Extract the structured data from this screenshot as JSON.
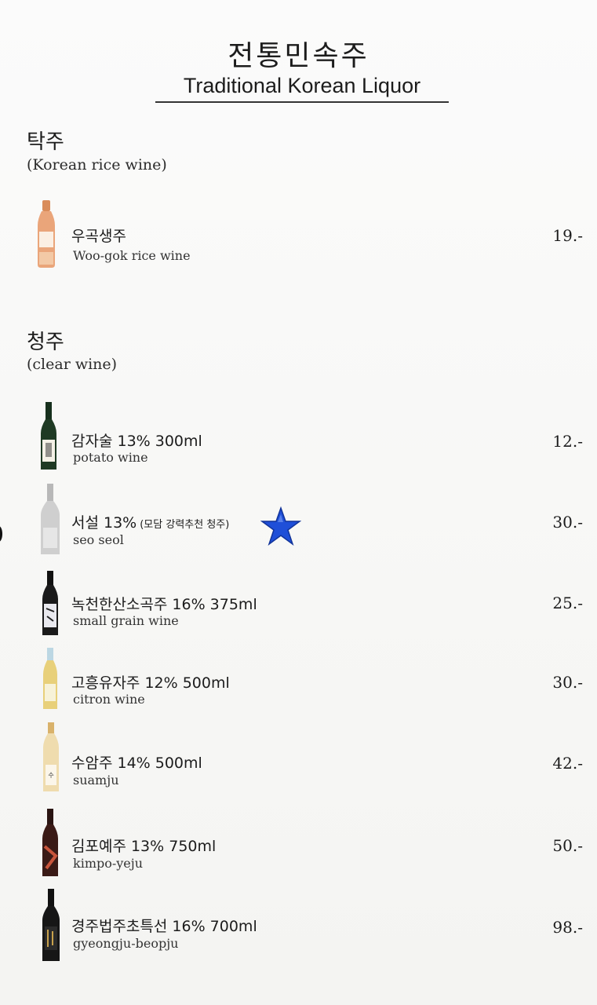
{
  "header": {
    "title_ko": "전통민속주",
    "title_en": "Traditional Korean Liquor"
  },
  "sections": [
    {
      "title": "탁주",
      "subtitle": "(Korean rice wine)",
      "items": [
        {
          "name": "우곡생주",
          "desc": "Woo-gok rice wine",
          "price": "19.-",
          "bottle_color": "#e9a57c"
        }
      ]
    },
    {
      "title": "청주",
      "subtitle": "(clear wine)",
      "items": [
        {
          "name": "감자술 13% 300ml",
          "desc": "potato wine",
          "price": "12.-",
          "bottle_color": "#1f3a24"
        },
        {
          "name": "서설 13%",
          "note": "(모담 강력추천 청주)",
          "desc": "seo seol",
          "price": "30.-",
          "bottle_color": "#c9c9c9",
          "badge": "star-icon",
          "badge_color": "#1f4fd8"
        },
        {
          "name": "녹천한산소곡주 16% 375ml",
          "desc": "small grain wine",
          "price": "25.-",
          "bottle_color": "#1a1a1a"
        },
        {
          "name": "고흥유자주 12% 500ml",
          "desc": "citron wine",
          "price": "30.-",
          "bottle_color": "#e8d07a"
        },
        {
          "name": "수암주 14% 500ml",
          "desc": "suamju",
          "price": "42.-",
          "bottle_color": "#efdcae"
        },
        {
          "name": "김포예주 13% 750ml",
          "desc": "kimpo-yeju",
          "price": "50.-",
          "bottle_color": "#2a1412"
        },
        {
          "name": "경주법주초특선 16% 700ml",
          "desc": "gyeongju-beopju",
          "price": "98.-",
          "bottle_color": "#161616"
        }
      ]
    }
  ]
}
